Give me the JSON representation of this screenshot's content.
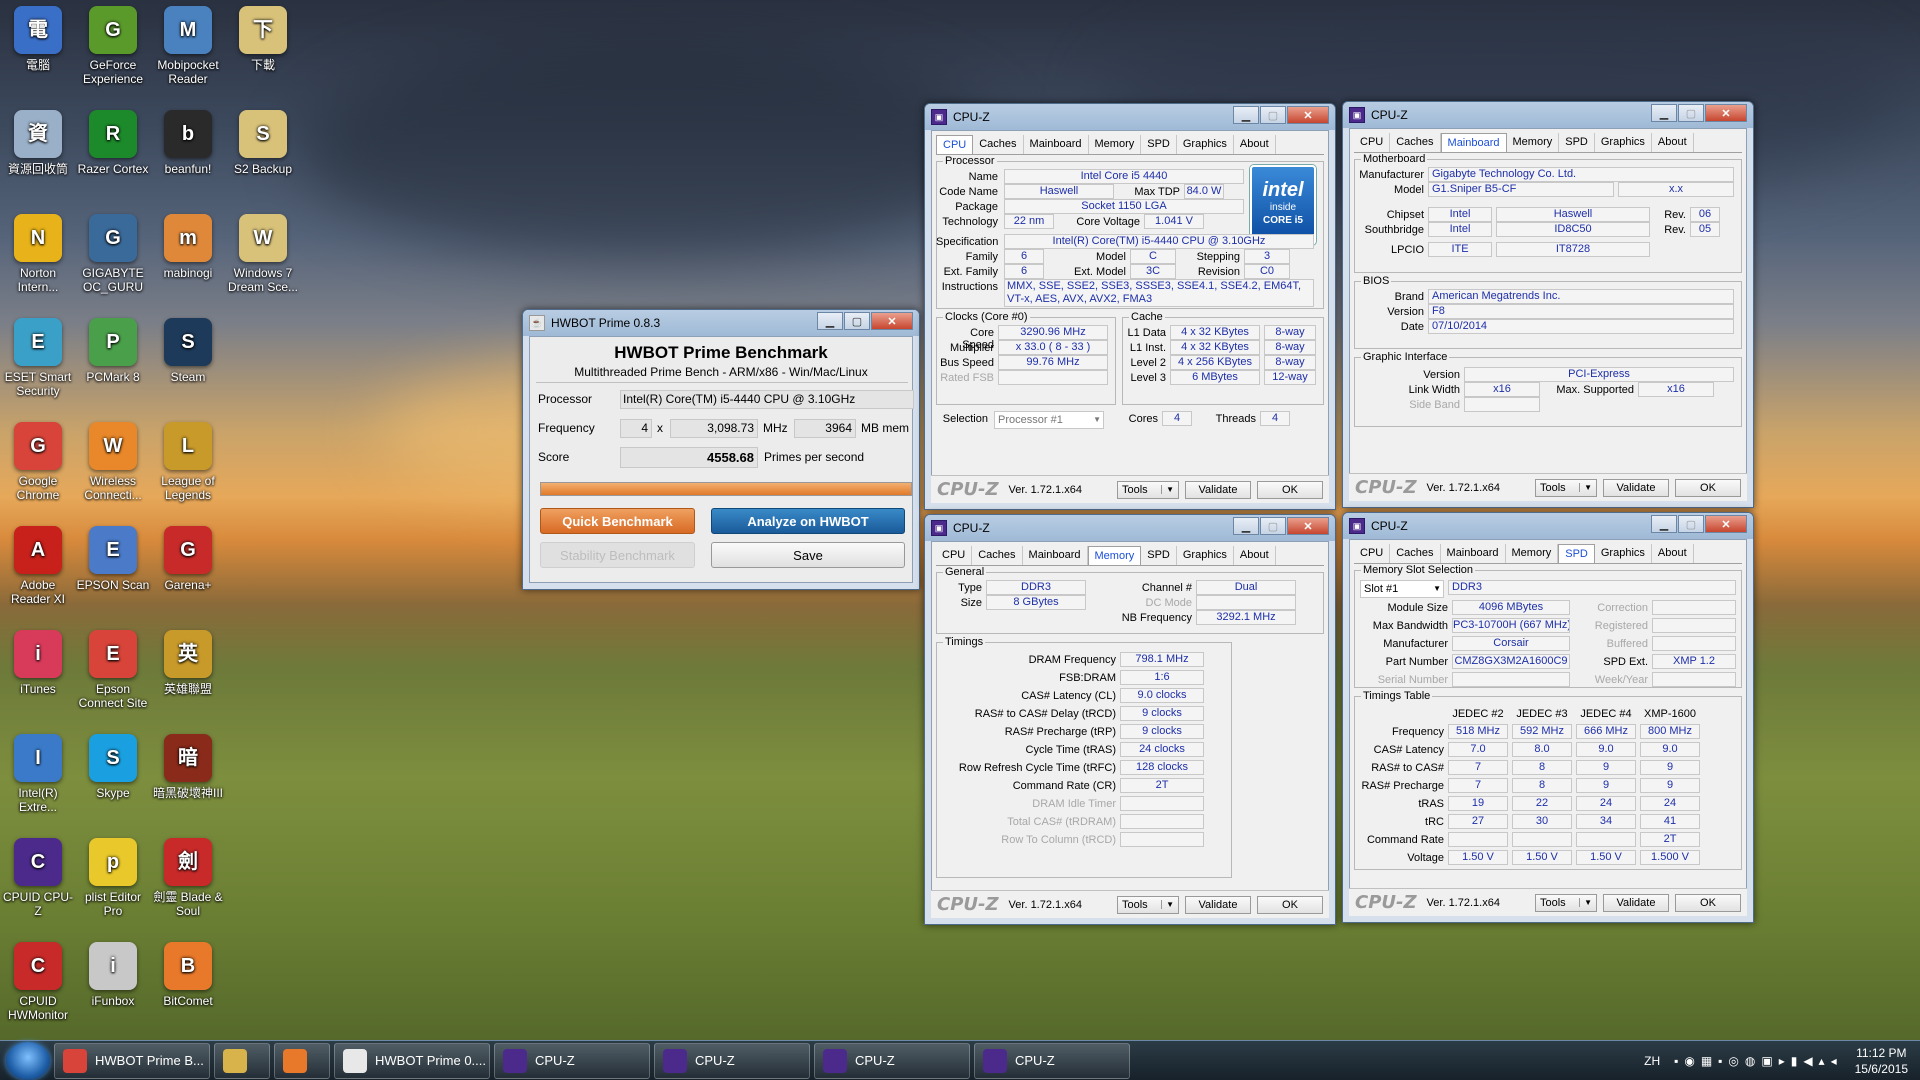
{
  "desktop_icons": [
    {
      "label": "電腦",
      "icon": "computer-icon",
      "color": "#3a6fc8"
    },
    {
      "label": "GeForce Experience",
      "icon": "geforce-icon",
      "color": "#5a9a2a"
    },
    {
      "label": "Mobipocket Reader",
      "icon": "mobipocket-icon",
      "color": "#4a82c0"
    },
    {
      "label": "下載",
      "icon": "folder-icon",
      "color": "#d8c27a"
    },
    {
      "label": "資源回收筒",
      "icon": "recycle-bin-icon",
      "color": "#9ab0c8"
    },
    {
      "label": "Razer Cortex",
      "icon": "razer-icon",
      "color": "#1c8a2a"
    },
    {
      "label": "beanfun!",
      "icon": "beanfun-icon",
      "color": "#2a2a2a"
    },
    {
      "label": "S2 Backup",
      "icon": "folder-icon",
      "color": "#d8c27a"
    },
    {
      "label": "Norton Intern...",
      "icon": "norton-icon",
      "color": "#e8b21a"
    },
    {
      "label": "GIGABYTE OC_GURU",
      "icon": "gigabyte-icon",
      "color": "#3a6a9a"
    },
    {
      "label": "mabinogi",
      "icon": "mabinogi-icon",
      "color": "#e0883a"
    },
    {
      "label": "Windows 7 Dream Sce...",
      "icon": "folder-icon",
      "color": "#d8c27a"
    },
    {
      "label": "ESET Smart Security",
      "icon": "eset-icon",
      "color": "#3aa0c8"
    },
    {
      "label": "PCMark 8",
      "icon": "pcmark-icon",
      "color": "#4aa04a"
    },
    {
      "label": "Steam",
      "icon": "steam-icon",
      "color": "#1e3a5a"
    },
    {
      "label": "",
      "icon": "",
      "color": ""
    },
    {
      "label": "Google Chrome",
      "icon": "chrome-icon",
      "color": "#d8443a"
    },
    {
      "label": "Wireless Connecti...",
      "icon": "dlink-icon",
      "color": "#e8882a"
    },
    {
      "label": "League of Legends",
      "icon": "lol-icon",
      "color": "#c89a2a"
    },
    {
      "label": "",
      "icon": "",
      "color": ""
    },
    {
      "label": "Adobe Reader XI",
      "icon": "adobe-icon",
      "color": "#c8201a"
    },
    {
      "label": "EPSON Scan",
      "icon": "epson-icon",
      "color": "#4a7ac8"
    },
    {
      "label": "Garena+",
      "icon": "garena-icon",
      "color": "#c82a2a"
    },
    {
      "label": "",
      "icon": "",
      "color": ""
    },
    {
      "label": "iTunes",
      "icon": "itunes-icon",
      "color": "#d83a5a"
    },
    {
      "label": "Epson Connect Site",
      "icon": "chrome-icon",
      "color": "#d8443a"
    },
    {
      "label": "英雄聯盟",
      "icon": "lol-tw-icon",
      "color": "#c89a2a"
    },
    {
      "label": "",
      "icon": "",
      "color": ""
    },
    {
      "label": "Intel(R) Extre...",
      "icon": "intel-xtu-icon",
      "color": "#3a7ac8"
    },
    {
      "label": "Skype",
      "icon": "skype-icon",
      "color": "#1aa0e0"
    },
    {
      "label": "暗黑破壞神III",
      "icon": "diablo-icon",
      "color": "#8a2a1a"
    },
    {
      "label": "",
      "icon": "",
      "color": ""
    },
    {
      "label": "CPUID CPU-Z",
      "icon": "cpuz-icon",
      "color": "#4b2a8c"
    },
    {
      "label": "plist Editor Pro",
      "icon": "plist-icon",
      "color": "#e8c82a"
    },
    {
      "label": "劍靈 Blade & Soul",
      "icon": "bns-icon",
      "color": "#c82a2a"
    },
    {
      "label": "",
      "icon": "",
      "color": ""
    },
    {
      "label": "CPUID HWMonitor",
      "icon": "hwmonitor-icon",
      "color": "#c82a2a"
    },
    {
      "label": "iFunbox",
      "icon": "ifunbox-icon",
      "color": "#c8c8c8"
    },
    {
      "label": "BitComet",
      "icon": "bitcomet-icon",
      "color": "#e8782a"
    }
  ],
  "hwbot": {
    "title": "HWBOT Prime 0.8.3",
    "heading": "HWBOT Prime Benchmark",
    "subheading": "Multithreaded Prime Bench - ARM/x86 - Win/Mac/Linux",
    "processor_label": "Processor",
    "processor": "Intel(R) Core(TM) i5-4440 CPU @ 3.10GHz",
    "frequency_label": "Frequency",
    "threads": "4",
    "x": "x",
    "freq": "3,098.73",
    "mhz": "MHz",
    "mem": "3964",
    "mem_unit": "MB mem",
    "score_label": "Score",
    "score": "4558.68",
    "score_unit": "Primes per second",
    "progress": 1.0,
    "quick": "Quick Benchmark",
    "analyze": "Analyze on HWBOT",
    "stability": "Stability Benchmark",
    "save": "Save"
  },
  "cpuz_common": {
    "title": "CPU-Z",
    "brand": "CPU-Z",
    "version": "Ver. 1.72.1.x64",
    "tools": "Tools",
    "validate": "Validate",
    "ok": "OK",
    "tabs": [
      "CPU",
      "Caches",
      "Mainboard",
      "Memory",
      "SPD",
      "Graphics",
      "About"
    ]
  },
  "cpu": {
    "processor": "Processor",
    "name_l": "Name",
    "name": "Intel Core i5 4440",
    "code_l": "Code Name",
    "code": "Haswell",
    "tdp_l": "Max TDP",
    "tdp": "84.0 W",
    "package_l": "Package",
    "package": "Socket 1150 LGA",
    "tech_l": "Technology",
    "tech": "22 nm",
    "volt_l": "Core Voltage",
    "volt": "1.041 V",
    "spec_l": "Specification",
    "spec": "Intel(R) Core(TM) i5-4440 CPU @ 3.10GHz",
    "family_l": "Family",
    "family": "6",
    "model_l": "Model",
    "model": "C",
    "step_l": "Stepping",
    "step": "3",
    "extfam_l": "Ext. Family",
    "extfam": "6",
    "extmod_l": "Ext. Model",
    "extmod": "3C",
    "rev_l": "Revision",
    "rev": "C0",
    "instr_l": "Instructions",
    "instr": "MMX, SSE, SSE2, SSE3, SSSE3, SSE4.1, SSE4.2, EM64T, VT-x, AES, AVX, AVX2, FMA3",
    "clocks": "Clocks (Core #0)",
    "cache": "Cache",
    "cs_l": "Core Speed",
    "cs": "3290.96 MHz",
    "mult_l": "Multiplier",
    "mult": "x 33.0 ( 8 - 33 )",
    "bus_l": "Bus Speed",
    "bus": "99.76 MHz",
    "fsb_l": "Rated FSB",
    "l1d_l": "L1 Data",
    "l1d": "4 x 32 KBytes",
    "l1d_w": "8-way",
    "l1i_l": "L1 Inst.",
    "l1i": "4 x 32 KBytes",
    "l1i_w": "8-way",
    "l2_l": "Level 2",
    "l2": "4 x 256 KBytes",
    "l2_w": "8-way",
    "l3_l": "Level 3",
    "l3": "6 MBytes",
    "l3_w": "12-way",
    "sel_l": "Selection",
    "sel": "Processor #1",
    "cores_l": "Cores",
    "cores": "4",
    "threads_l": "Threads",
    "threads": "4",
    "intel1": "intel",
    "intel2": "inside",
    "intel3": "CORE i5"
  },
  "mainboard": {
    "mb": "Motherboard",
    "man_l": "Manufacturer",
    "man": "Gigabyte Technology Co. Ltd.",
    "model_l": "Model",
    "model": "G1.Sniper B5-CF",
    "model2": "x.x",
    "chip_l": "Chipset",
    "chip_v": "Intel",
    "chip": "Haswell",
    "rev_l": "Rev.",
    "chip_r": "06",
    "sb_l": "Southbridge",
    "sb_v": "Intel",
    "sb": "ID8C50",
    "sb_r": "05",
    "lpc_l": "LPCIO",
    "lpc_v": "ITE",
    "lpc": "IT8728",
    "bios": "BIOS",
    "brand_l": "Brand",
    "brand": "American Megatrends Inc.",
    "ver_l": "Version",
    "ver": "F8",
    "date_l": "Date",
    "date": "07/10/2014",
    "gi": "Graphic Interface",
    "gv_l": "Version",
    "gv": "PCI-Express",
    "lw_l": "Link Width",
    "lw": "x16",
    "ms_l": "Max. Supported",
    "ms": "x16",
    "sideband_l": "Side Band"
  },
  "memory": {
    "general": "General",
    "type_l": "Type",
    "type": "DDR3",
    "ch_l": "Channel #",
    "ch": "Dual",
    "size_l": "Size",
    "size": "8 GBytes",
    "dc_l": "DC Mode",
    "nb_l": "NB Frequency",
    "nb": "3292.1 MHz",
    "timings": "Timings",
    "rows": [
      {
        "l": "DRAM Frequency",
        "v": "798.1 MHz",
        "dim": false
      },
      {
        "l": "FSB:DRAM",
        "v": "1:6",
        "dim": false
      },
      {
        "l": "CAS# Latency (CL)",
        "v": "9.0 clocks",
        "dim": false
      },
      {
        "l": "RAS# to CAS# Delay (tRCD)",
        "v": "9 clocks",
        "dim": false
      },
      {
        "l": "RAS# Precharge (tRP)",
        "v": "9 clocks",
        "dim": false
      },
      {
        "l": "Cycle Time (tRAS)",
        "v": "24 clocks",
        "dim": false
      },
      {
        "l": "Row Refresh Cycle Time (tRFC)",
        "v": "128 clocks",
        "dim": false
      },
      {
        "l": "Command Rate (CR)",
        "v": "2T",
        "dim": false
      },
      {
        "l": "DRAM Idle Timer",
        "v": "",
        "dim": true
      },
      {
        "l": "Total CAS# (tRDRAM)",
        "v": "",
        "dim": true
      },
      {
        "l": "Row To Column (tRCD)",
        "v": "",
        "dim": true
      }
    ]
  },
  "spd": {
    "slotsel": "Memory Slot Selection",
    "slot": "Slot #1",
    "slot_type": "DDR3",
    "msize_l": "Module Size",
    "msize": "4096 MBytes",
    "corr_l": "Correction",
    "bw_l": "Max Bandwidth",
    "bw": "PC3-10700H (667 MHz)",
    "reg_l": "Registered",
    "man_l": "Manufacturer",
    "man": "Corsair",
    "buf_l": "Buffered",
    "pn_l": "Part Number",
    "pn": "CMZ8GX3M2A1600C9",
    "ext_l": "SPD Ext.",
    "ext": "XMP 1.2",
    "sn_l": "Serial Number",
    "week_l": "Week/Year",
    "tt": "Timings Table",
    "cols": [
      "JEDEC #2",
      "JEDEC #3",
      "JEDEC #4",
      "XMP-1600"
    ],
    "rows": [
      {
        "l": "Frequency",
        "v": [
          "518 MHz",
          "592 MHz",
          "666 MHz",
          "800 MHz"
        ]
      },
      {
        "l": "CAS# Latency",
        "v": [
          "7.0",
          "8.0",
          "9.0",
          "9.0"
        ]
      },
      {
        "l": "RAS# to CAS#",
        "v": [
          "7",
          "8",
          "9",
          "9"
        ]
      },
      {
        "l": "RAS# Precharge",
        "v": [
          "7",
          "8",
          "9",
          "9"
        ]
      },
      {
        "l": "tRAS",
        "v": [
          "19",
          "22",
          "24",
          "24"
        ]
      },
      {
        "l": "tRC",
        "v": [
          "27",
          "30",
          "34",
          "41"
        ]
      },
      {
        "l": "Command Rate",
        "v": [
          "",
          "",
          "",
          "2T"
        ]
      },
      {
        "l": "Voltage",
        "v": [
          "1.50 V",
          "1.50 V",
          "1.50 V",
          "1.500 V"
        ]
      }
    ]
  },
  "taskbar": {
    "items": [
      {
        "label": "HWBOT Prime B...",
        "icon": "chrome-icon",
        "color": "#d8443a"
      },
      {
        "label": "",
        "icon": "explorer-icon",
        "color": "#d8b24a"
      },
      {
        "label": "",
        "icon": "media-player-icon",
        "color": "#e8782a"
      },
      {
        "label": "HWBOT Prime 0....",
        "icon": "java-icon",
        "color": "#e8e8e8"
      },
      {
        "label": "CPU-Z",
        "icon": "cpuz-icon",
        "color": "#4b2a8c"
      },
      {
        "label": "CPU-Z",
        "icon": "cpuz-icon",
        "color": "#4b2a8c"
      },
      {
        "label": "CPU-Z",
        "icon": "cpuz-icon",
        "color": "#4b2a8c"
      },
      {
        "label": "CPU-Z",
        "icon": "cpuz-icon",
        "color": "#4b2a8c"
      }
    ],
    "lang": "ZH",
    "time": "11:12 PM",
    "date": "15/6/2015"
  }
}
